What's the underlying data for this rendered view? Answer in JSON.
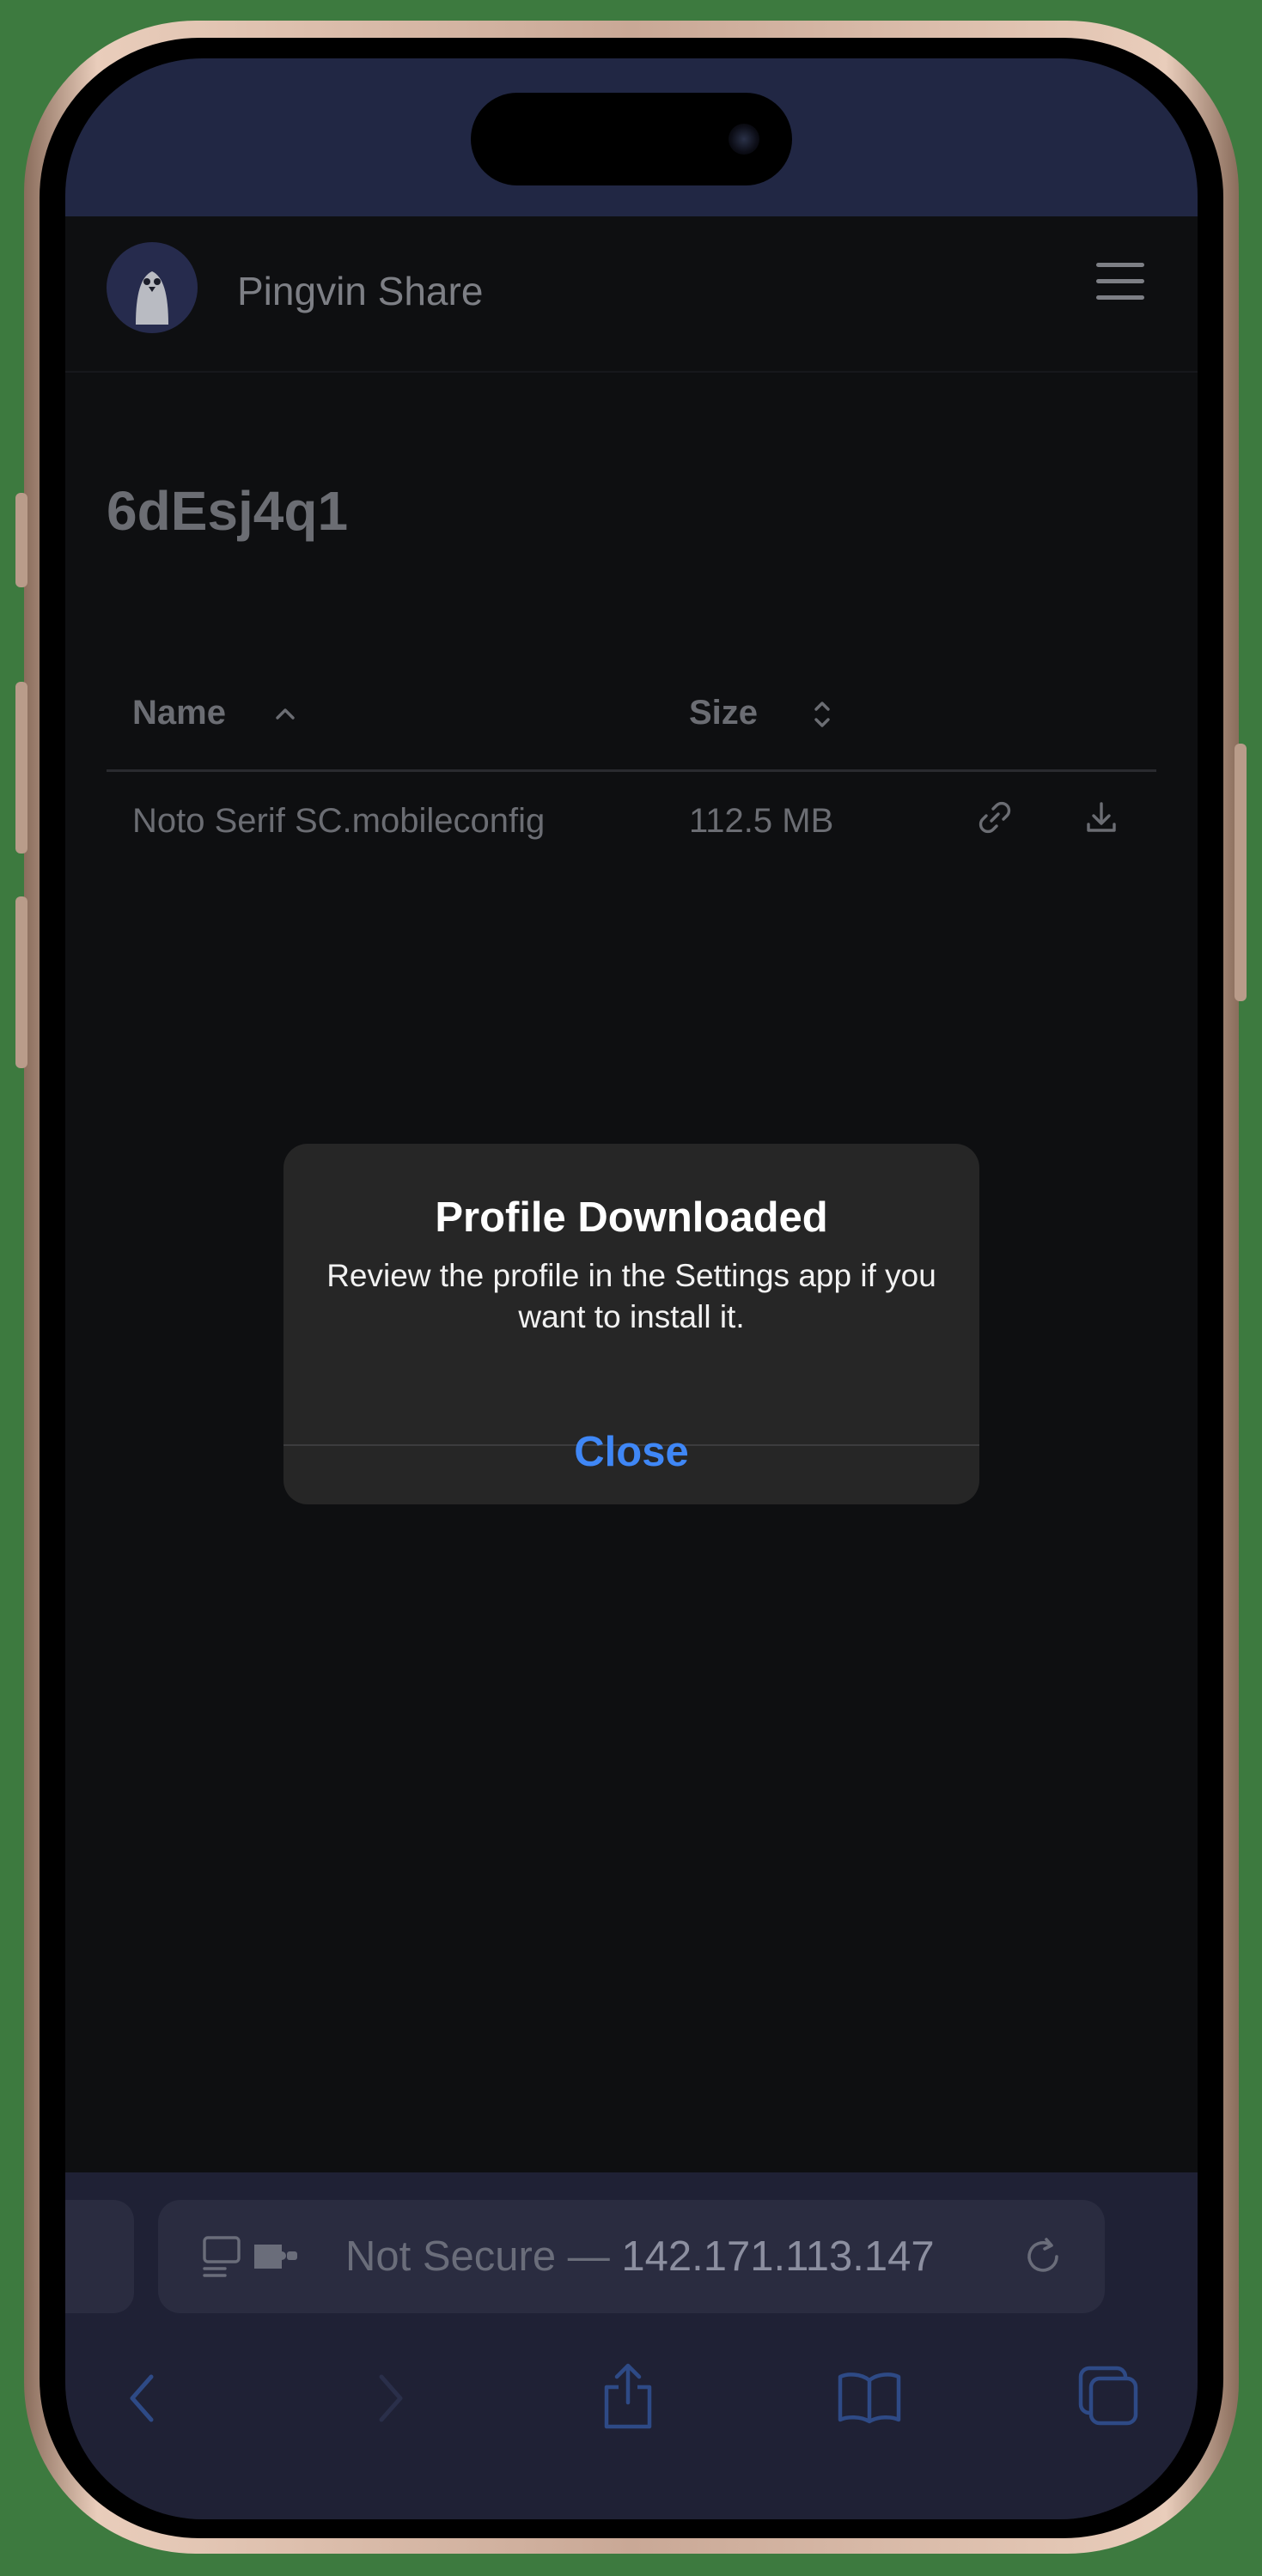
{
  "app": {
    "name": "Pingvin Share"
  },
  "share": {
    "id": "6dEsj4q1"
  },
  "table": {
    "columns": [
      {
        "label": "Name",
        "sort": "ascending"
      },
      {
        "label": "Size",
        "sort": "none"
      }
    ],
    "rows": [
      {
        "name": "Noto Serif SC.mobileconfig",
        "size": "112.5 MB"
      }
    ]
  },
  "alert": {
    "title": "Profile Downloaded",
    "message": "Review the profile in the Settings app if you want to install it.",
    "button": "Close"
  },
  "browser": {
    "security": "Not Secure —",
    "host": "142.171.113.147"
  },
  "colors": {
    "status_bar": "#212744",
    "page_bg": "#0e0f11",
    "alert_bg": "#262626",
    "alert_button": "#3f87f6",
    "safari_bar": "#1f2135"
  },
  "icons": [
    "menu-icon",
    "sort-ascending-icon",
    "sort-both-icon",
    "link-icon",
    "download-icon",
    "reader-icon",
    "extension-icon",
    "reload-icon",
    "back-icon",
    "forward-icon",
    "share-icon",
    "bookmarks-icon",
    "tabs-icon"
  ]
}
